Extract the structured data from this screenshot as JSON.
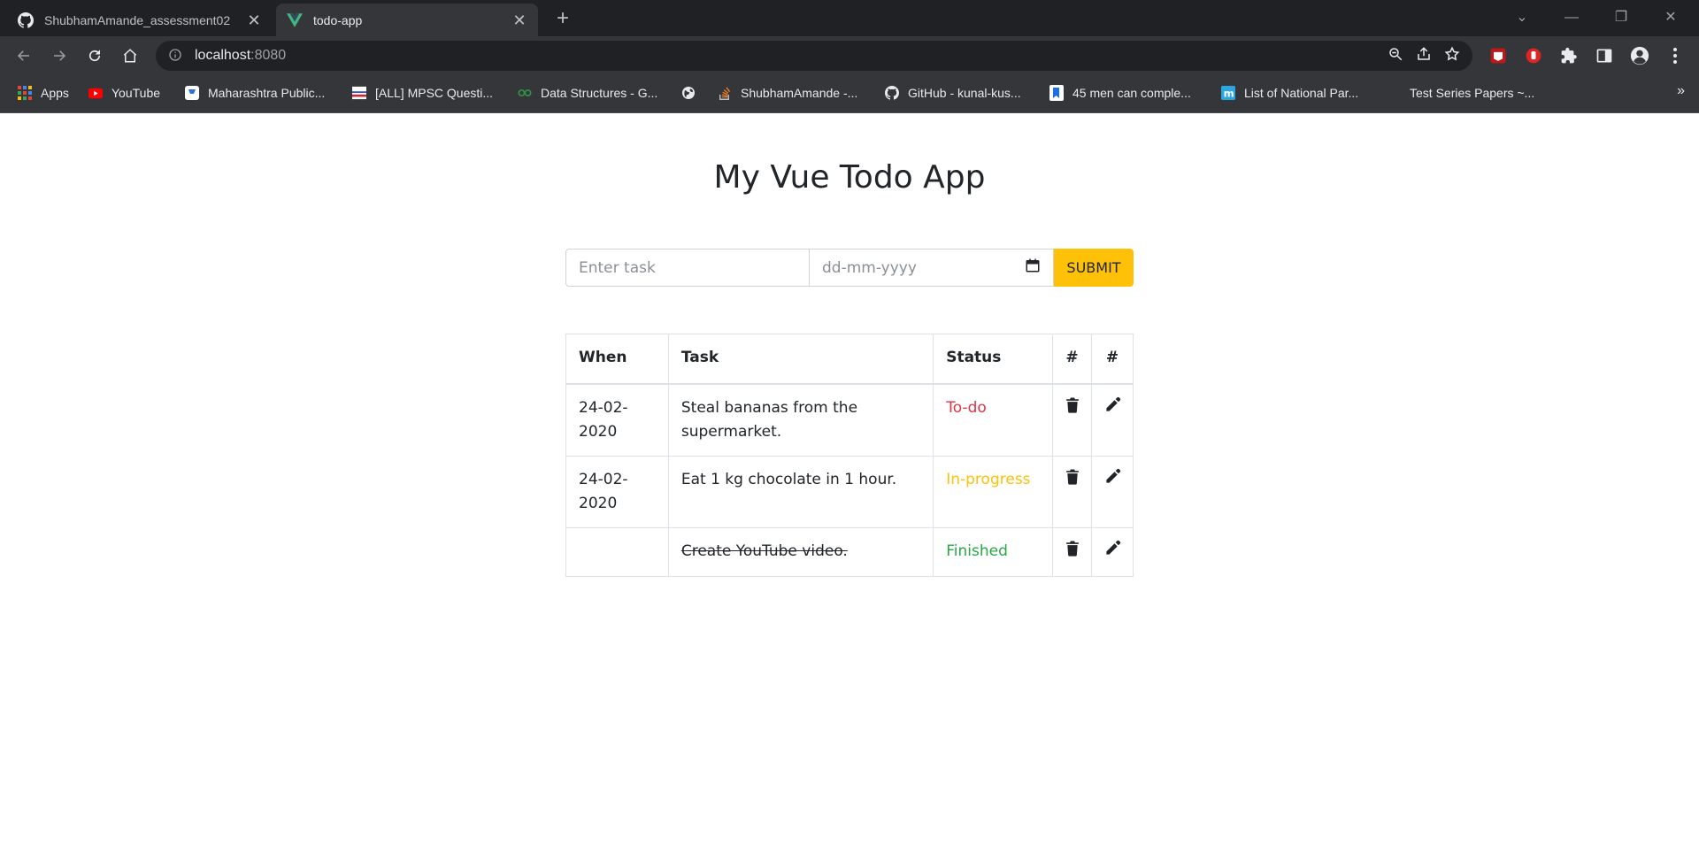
{
  "browser": {
    "tabs": [
      {
        "title": "ShubhamAmande_assessment02",
        "icon": "github-icon",
        "active": false
      },
      {
        "title": "todo-app",
        "icon": "vue-icon",
        "active": true
      }
    ],
    "address": {
      "host": "localhost",
      "port": ":8080"
    },
    "bookmarks": [
      {
        "label": "Apps",
        "icon": "apps-grid-icon"
      },
      {
        "label": "YouTube",
        "icon": "youtube-icon"
      },
      {
        "label": "Maharashtra Public...",
        "icon": "bookmark-app-icon"
      },
      {
        "label": "[ALL] MPSC Questi...",
        "icon": "mpsc-icon"
      },
      {
        "label": "Data Structures - G...",
        "icon": "gfg-icon"
      },
      {
        "label": "",
        "icon": "globe-icon"
      },
      {
        "label": "ShubhamAmande -...",
        "icon": "stackoverflow-icon"
      },
      {
        "label": "GitHub - kunal-kus...",
        "icon": "github-icon"
      },
      {
        "label": "45 men can comple...",
        "icon": "bookmark-doc-icon"
      },
      {
        "label": "List of National Par...",
        "icon": "m-icon"
      },
      {
        "label": "Test Series Papers ~...",
        "icon": ""
      }
    ]
  },
  "app": {
    "title": "My Vue Todo App",
    "form": {
      "task_placeholder": "Enter task",
      "date_placeholder": "dd-mm-yyyy",
      "submit_label": "SUBMIT"
    },
    "table": {
      "headers": [
        "When",
        "Task",
        "Status",
        "#",
        "#"
      ],
      "rows": [
        {
          "when": "24-02-2020",
          "task": "Steal bananas from the supermarket.",
          "status": "To-do",
          "status_color": "#dc3545",
          "finished": false
        },
        {
          "when": "24-02-2020",
          "task": "Eat 1 kg chocolate in 1 hour.",
          "status": "In-progress",
          "status_color": "#ffc107",
          "finished": false
        },
        {
          "when": "",
          "task": "Create YouTube video.",
          "status": "Finished",
          "status_color": "#28a745",
          "finished": true
        }
      ]
    }
  },
  "colors": {
    "accent": "#ffc107",
    "chrome_dark": "#202124",
    "chrome_mid": "#35363a"
  }
}
